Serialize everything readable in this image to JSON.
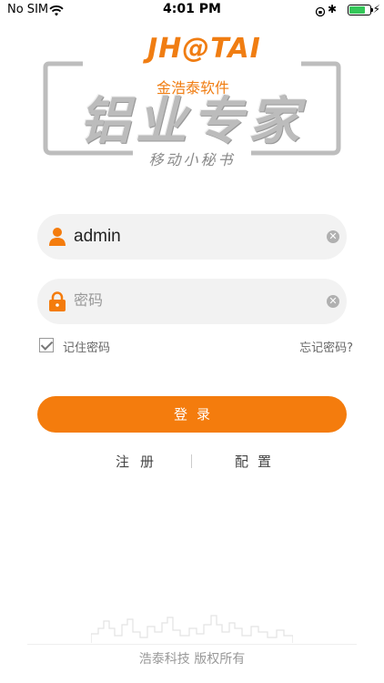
{
  "status_bar": {
    "carrier": "No SIM",
    "time": "4:01 PM",
    "battery_level": 0.7,
    "icons": [
      "wifi-icon",
      "rotation-lock-icon",
      "bluetooth-icon",
      "battery-icon",
      "charging-icon"
    ]
  },
  "logo": {
    "company_mark": "JH@TAI",
    "company_name": "金浩泰软件",
    "product_name": "铝业专家",
    "tagline": "移动小秘书",
    "accent_color": "#f07d12"
  },
  "form": {
    "username": {
      "value": "admin",
      "icon": "user-icon"
    },
    "password": {
      "placeholder": "密码",
      "icon": "lock-icon"
    },
    "remember_label": "记住密码",
    "remember_checked": true,
    "forgot_label": "忘记密码?",
    "login_label": "登录"
  },
  "links": {
    "register": "注册",
    "config": "配置"
  },
  "footer": {
    "copyright": "浩泰科技  版权所有"
  },
  "colors": {
    "primary": "#f47c0d",
    "field_bg": "#f2f2f2"
  }
}
